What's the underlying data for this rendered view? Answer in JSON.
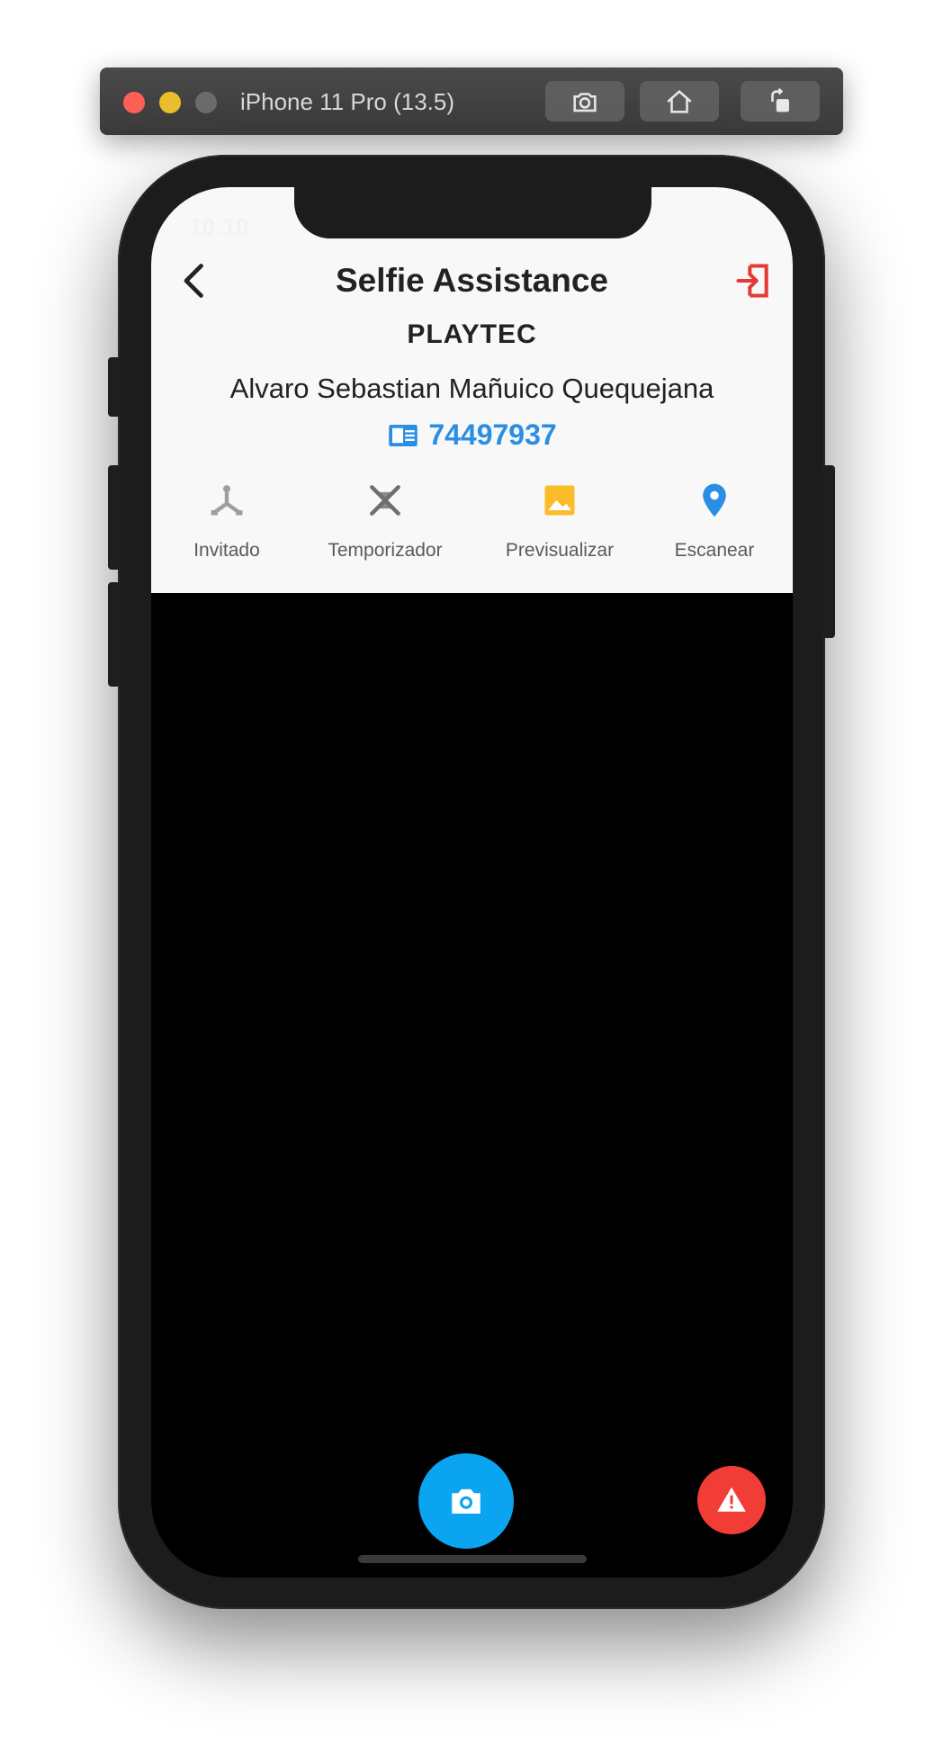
{
  "simulator": {
    "title": "iPhone 11 Pro (13.5)",
    "buttons": [
      "screenshot-icon",
      "home-icon",
      "rotate-icon"
    ]
  },
  "status_bar": {
    "time": "10:10"
  },
  "nav": {
    "title": "Selfie Assistance",
    "back_icon": "chevron-left-icon",
    "logout_icon": "logout-icon",
    "logout_color": "#e53935"
  },
  "company": "PLAYTEC",
  "person_name": "Alvaro Sebastian Mañuico Quequejana",
  "document": {
    "icon": "id-card-icon",
    "number": "74497937",
    "color": "#2a8ee4"
  },
  "actions": [
    {
      "label": "Invitado",
      "icon": "merge-icon",
      "color": "#9e9e9e"
    },
    {
      "label": "Temporizador",
      "icon": "timer-off-icon",
      "color": "#9e9e9e"
    },
    {
      "label": "Previsualizar",
      "icon": "image-icon",
      "color": "#fbbc2a"
    },
    {
      "label": "Escanear",
      "icon": "location-pin-icon",
      "color": "#2a8ee4"
    }
  ],
  "camera_button": {
    "icon": "camera-icon",
    "color": "#0aa4f0"
  },
  "alert_button": {
    "icon": "warning-icon",
    "color": "#f23d36"
  }
}
